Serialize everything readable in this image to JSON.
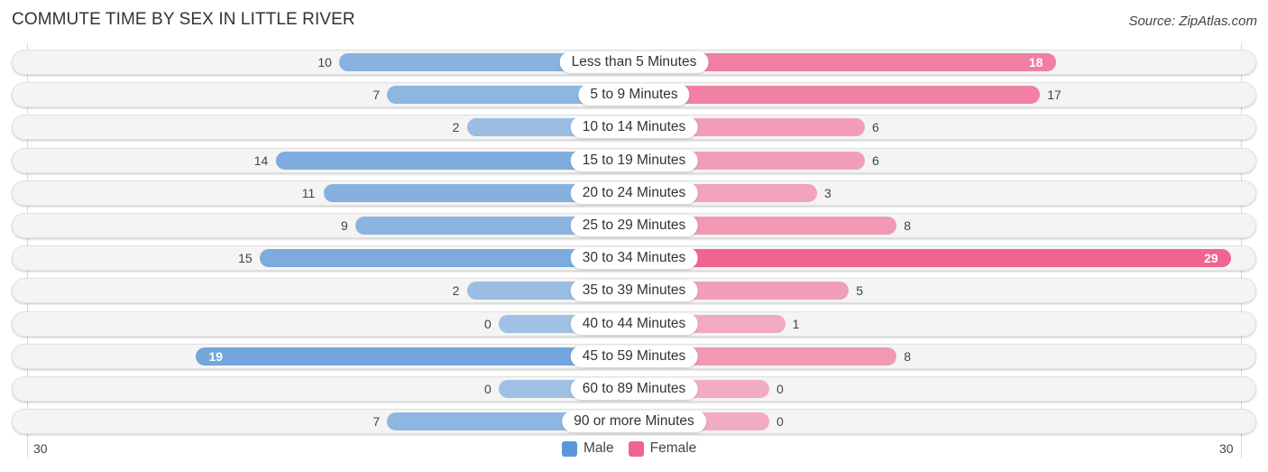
{
  "title": "COMMUTE TIME BY SEX IN LITTLE RIVER",
  "source": "Source: ZipAtlas.com",
  "colors": {
    "male": "#6ea3dc",
    "female": "#f47fa4",
    "male_strong": "#5b96d8",
    "female_strong": "#f0648f"
  },
  "chart_data": {
    "type": "bar",
    "orientation": "horizontal-diverging",
    "title": "COMMUTE TIME BY SEX IN LITTLE RIVER",
    "categories": [
      "Less than 5 Minutes",
      "5 to 9 Minutes",
      "10 to 14 Minutes",
      "15 to 19 Minutes",
      "20 to 24 Minutes",
      "25 to 29 Minutes",
      "30 to 34 Minutes",
      "35 to 39 Minutes",
      "40 to 44 Minutes",
      "45 to 59 Minutes",
      "60 to 89 Minutes",
      "90 or more Minutes"
    ],
    "series": [
      {
        "name": "Male",
        "values": [
          10,
          7,
          2,
          14,
          11,
          9,
          15,
          2,
          0,
          19,
          0,
          7
        ]
      },
      {
        "name": "Female",
        "values": [
          18,
          17,
          6,
          6,
          3,
          8,
          29,
          5,
          1,
          8,
          0,
          0
        ]
      }
    ],
    "axis": {
      "min_label": "30",
      "max_label": "30",
      "range": [
        0,
        30
      ]
    },
    "legend": {
      "position": "bottom-center",
      "entries": [
        "Male",
        "Female"
      ]
    },
    "grid": false
  }
}
